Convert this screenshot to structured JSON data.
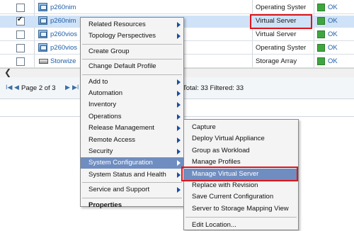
{
  "grid": {
    "rows": [
      {
        "checked": false,
        "name": "p260nim",
        "type": "Operating Syster",
        "state": "OK",
        "icon": "server-icon"
      },
      {
        "checked": true,
        "name": "p260nim",
        "type": "Virtual Server",
        "state": "OK",
        "icon": "server-icon"
      },
      {
        "checked": false,
        "name": "p260vios",
        "type": "Virtual Server",
        "state": "OK",
        "icon": "server-icon"
      },
      {
        "checked": false,
        "name": "p260vios",
        "type": "Operating Syster",
        "state": "OK",
        "icon": "server-icon"
      },
      {
        "checked": false,
        "name": "Storwize",
        "type": "Storage Array",
        "state": "OK",
        "icon": "storage-icon"
      }
    ]
  },
  "pager": {
    "first": "I◀",
    "prev": "◀",
    "page": "Page 2 of 3",
    "next": "▶",
    "last": "▶I",
    "totals": "Total: 33   Filtered: 33"
  },
  "context_menu": {
    "items": [
      {
        "label": "Related Resources",
        "submenu": true,
        "bold": false
      },
      {
        "label": "Topology Perspectives",
        "submenu": true,
        "bold": false
      },
      {
        "separator": true
      },
      {
        "label": "Create Group",
        "submenu": false,
        "bold": false
      },
      {
        "separator": true
      },
      {
        "label": "Change Default Profile",
        "submenu": false,
        "bold": false
      },
      {
        "separator": true
      },
      {
        "label": "Add to",
        "submenu": true,
        "bold": false
      },
      {
        "label": "Automation",
        "submenu": true,
        "bold": false
      },
      {
        "label": "Inventory",
        "submenu": true,
        "bold": false
      },
      {
        "label": "Operations",
        "submenu": true,
        "bold": false
      },
      {
        "label": "Release Management",
        "submenu": true,
        "bold": false
      },
      {
        "label": "Remote Access",
        "submenu": true,
        "bold": false
      },
      {
        "label": "Security",
        "submenu": true,
        "bold": false
      },
      {
        "label": "System Configuration",
        "submenu": true,
        "bold": false,
        "active": true
      },
      {
        "label": "System Status and Health",
        "submenu": true,
        "bold": false
      },
      {
        "separator": true
      },
      {
        "label": "Service and Support",
        "submenu": true,
        "bold": false
      },
      {
        "separator": true
      },
      {
        "label": "Properties",
        "submenu": false,
        "bold": true
      }
    ]
  },
  "submenu": {
    "items": [
      {
        "label": "Capture"
      },
      {
        "label": "Deploy Virtual Appliance"
      },
      {
        "label": "Group as Workload"
      },
      {
        "label": "Manage Profiles"
      },
      {
        "label": "Manage Virtual Server",
        "active": true
      },
      {
        "label": "Replace with Revision"
      },
      {
        "label": "Save Current Configuration"
      },
      {
        "label": "Server to Storage Mapping View"
      },
      {
        "separator": true
      },
      {
        "label": "Edit Location..."
      }
    ]
  },
  "colors": {
    "selected_row": "#cfe2f7",
    "menu_active": "#6f8dc0",
    "callout_red": "#e0141b",
    "ok_green": "#3fa63f",
    "link_blue": "#1f5fa8"
  }
}
